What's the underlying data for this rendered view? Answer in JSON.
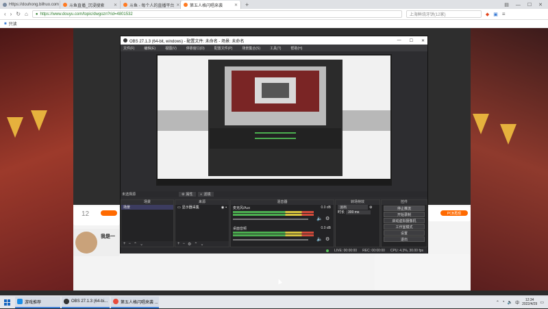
{
  "browser": {
    "tabs": [
      {
        "title": "Https://douhong.bilhuo.com",
        "color": "#7a8aa0"
      },
      {
        "title": "斗鱼直播_沉浸搜索",
        "color": "#ff7a21"
      },
      {
        "title": "斗鱼 - 每个人的直播平台",
        "color": "#ff7a21"
      },
      {
        "title": "第五人格闪唱来袭",
        "color": "#ff7a21"
      }
    ],
    "url": "https://www.douyu.com/topic/dwgozn?rid=4801532",
    "search_placeholder": "上海鲜烧牙饼(12家)",
    "bookmark": "只读"
  },
  "obs": {
    "title": "OBS 27.1.3 (64-bit, windows) - 配置文件: 未命名 - 场景: 未命名",
    "menu": [
      "文件(F)",
      "编辑(E)",
      "视图(V)",
      "停靠窗口(D)",
      "配置文件(P)",
      "场景集合(S)",
      "工具(T)",
      "帮助(H)"
    ],
    "source_bar": {
      "label": "未选择源",
      "props": "属性",
      "filters": "滤镜"
    },
    "docks": {
      "scenes": {
        "header": "场景",
        "items": [
          "场景"
        ]
      },
      "sources": {
        "header": "来源",
        "items": [
          "显示器采集"
        ]
      },
      "mixer": {
        "header": "混音器",
        "channels": [
          {
            "name": "麦克风/Aux",
            "db": "0.0 dB"
          },
          {
            "name": "桌面音频",
            "db": "0.0 dB"
          }
        ]
      },
      "transitions": {
        "header": "转场特效",
        "type": "淡出",
        "duration_label": "时长",
        "duration": "300 ms"
      },
      "controls": {
        "header": "控件",
        "buttons": [
          "停止推流",
          "开始录制",
          "启动虚拟摄像机",
          "工作室模式",
          "设置",
          "退出"
        ]
      }
    },
    "status": {
      "live": "LIVE: 00:00:00",
      "rec": "REC: 00:00:00",
      "cpu": "CPU: 4.3%, 30.00 fps"
    }
  },
  "page": {
    "left_card": {
      "count": "12",
      "title": "我是一"
    },
    "right_card": {
      "title": "PCB再现"
    }
  },
  "taskbar": {
    "items": [
      {
        "label": "游戏推荐",
        "color": "#1b8fe8"
      },
      {
        "label": "OBS 27.1.3 (64-bi...",
        "color": "#333"
      },
      {
        "label": "第五人格闪唱来袭 ...",
        "color": "#e84b3c"
      }
    ],
    "time": "12:34",
    "date": "2022/4/29"
  }
}
